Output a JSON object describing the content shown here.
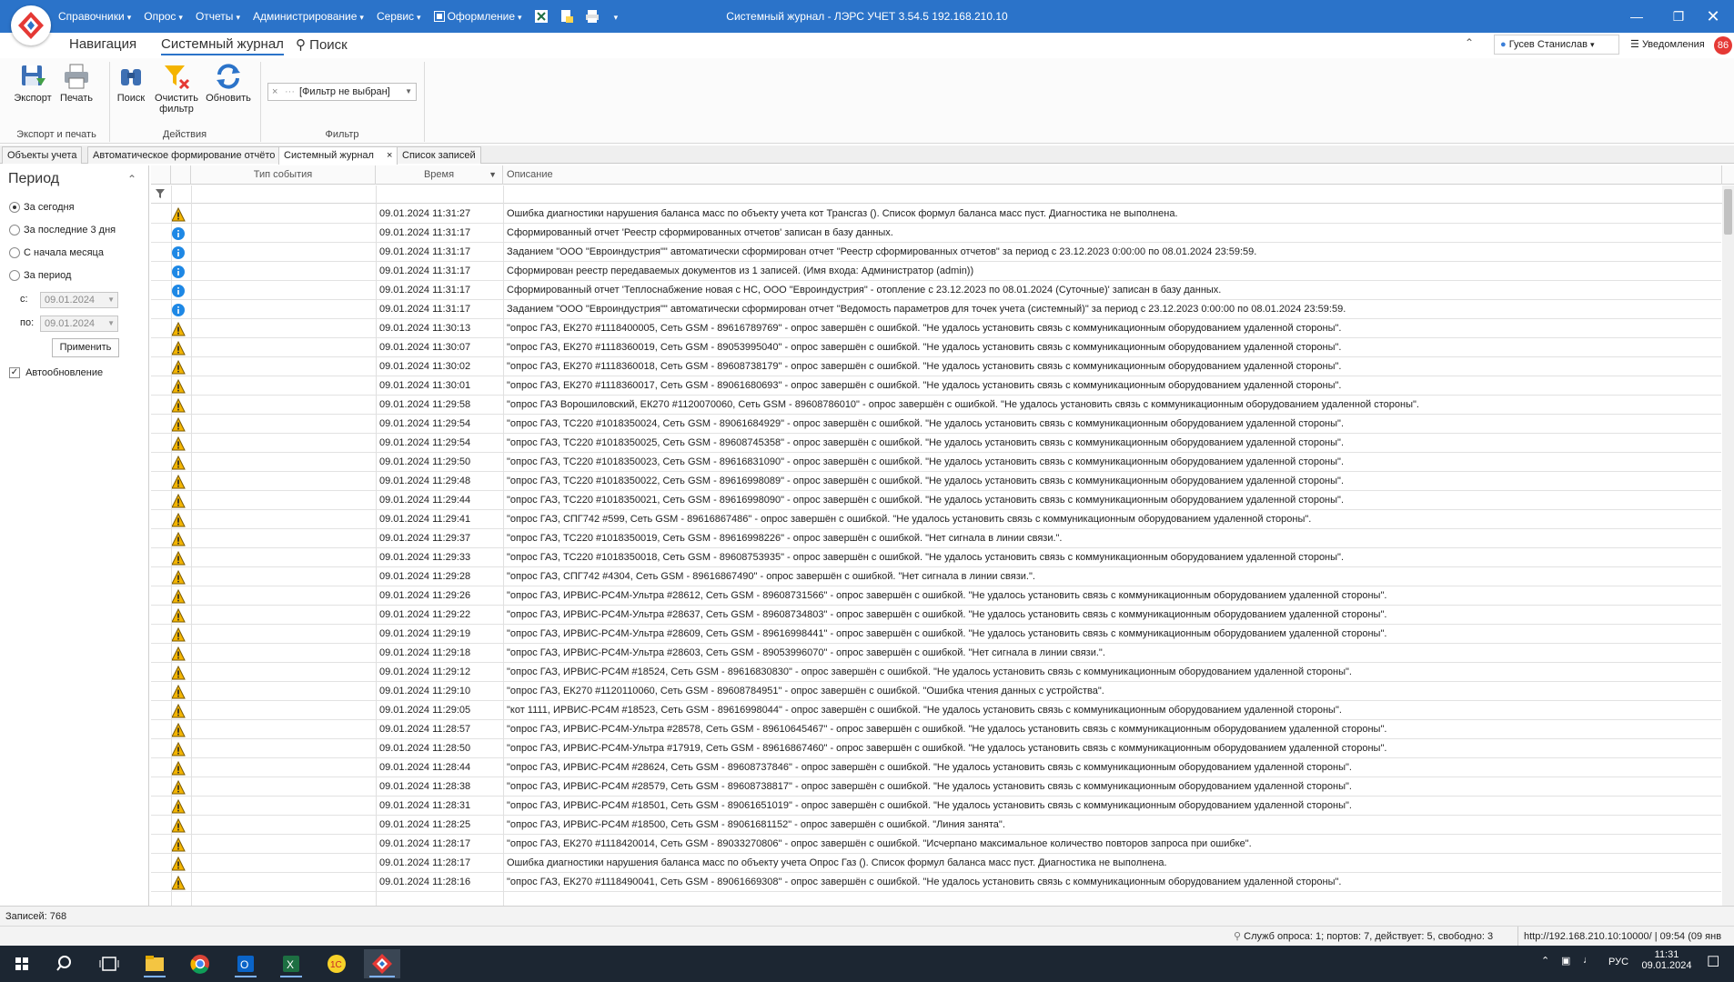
{
  "app": {
    "title": "Системный журнал - ЛЭРС УЧЕТ 3.54.5 192.168.210.10",
    "menu": [
      "Справочники",
      "Опрос",
      "Отчеты",
      "Администрирование",
      "Сервис",
      "Оформление"
    ],
    "window_controls": [
      "minimize",
      "restore",
      "close"
    ]
  },
  "ribbon_tabs": {
    "navigation": "Навигация",
    "journal": "Системный журнал",
    "search": "Поиск"
  },
  "user": {
    "name": "Гусев Станислав",
    "notifications_label": "Уведомления",
    "notifications_count": "86"
  },
  "ribbon": {
    "export": "Экспорт",
    "print": "Печать",
    "group_export": "Экспорт и печать",
    "search": "Поиск",
    "clear_filter_1": "Очистить",
    "clear_filter_2": "фильтр",
    "refresh": "Обновить",
    "group_actions": "Действия",
    "filter_value": "[Фильтр не выбран]",
    "group_filter": "Фильтр"
  },
  "doc_tabs": [
    "Объекты учета",
    "Автоматическое формирование отчёто",
    "Системный журнал",
    "Список записей"
  ],
  "period": {
    "title": "Период",
    "options": [
      "За сегодня",
      "За последние 3 дня",
      "С начала месяца",
      "За период"
    ],
    "selected": 0,
    "from_label": "с:",
    "from_value": "09.01.2024",
    "to_label": "по:",
    "to_value": "09.01.2024",
    "apply": "Применить",
    "autoupdate": "Автообновление",
    "autoupdate_checked": true
  },
  "grid": {
    "columns": [
      "Тип события",
      "Время",
      "Описание"
    ],
    "rows": [
      {
        "type": "warning",
        "time": "09.01.2024 11:31:27",
        "desc": "Ошибка диагностики нарушения баланса масс по объекту учета кот Трансгаз (). Список формул баланса масс пуст. Диагностика не выполнена."
      },
      {
        "type": "info",
        "time": "09.01.2024 11:31:17",
        "desc": "Сформированный отчет 'Реестр сформированных отчетов' записан в базу данных."
      },
      {
        "type": "info",
        "time": "09.01.2024 11:31:17",
        "desc": "Заданием \"ООО \"Евроиндустрия\"\" автоматически сформирован отчет \"Реестр сформированных отчетов\" за период с 23.12.2023 0:00:00 по 08.01.2024 23:59:59."
      },
      {
        "type": "info",
        "time": "09.01.2024 11:31:17",
        "desc": "Сформирован реестр передаваемых документов из 1 записей.  (Имя входа: Администратор (admin))"
      },
      {
        "type": "info",
        "time": "09.01.2024 11:31:17",
        "desc": "Сформированный отчет 'Теплоснабжение новая с НС, ООО \"Евроиндустрия\" - отопление с 23.12.2023 по 08.01.2024 (Суточные)' записан в базу данных."
      },
      {
        "type": "info",
        "time": "09.01.2024 11:31:17",
        "desc": "Заданием \"ООО \"Евроиндустрия\"\" автоматически сформирован отчет \"Ведомость параметров для точек учета (системный)\" за период с 23.12.2023 0:00:00 по 08.01.2024 23:59:59."
      },
      {
        "type": "warning",
        "time": "09.01.2024 11:30:13",
        "desc": "\"опрос ГАЗ, ЕК270 #1118400005, Сеть GSM - 89616789769\" - опрос завершён с ошибкой. \"Не удалось установить связь с коммуникационным оборудованием удаленной стороны\"."
      },
      {
        "type": "warning",
        "time": "09.01.2024 11:30:07",
        "desc": "\"опрос ГАЗ, ЕК270 #1118360019, Сеть GSM - 89053995040\" - опрос завершён с ошибкой. \"Не удалось установить связь с коммуникационным оборудованием удаленной стороны\"."
      },
      {
        "type": "warning",
        "time": "09.01.2024 11:30:02",
        "desc": "\"опрос ГАЗ, ЕК270 #1118360018, Сеть GSM - 89608738179\" - опрос завершён с ошибкой. \"Не удалось установить связь с коммуникационным оборудованием удаленной стороны\"."
      },
      {
        "type": "warning",
        "time": "09.01.2024 11:30:01",
        "desc": "\"опрос ГАЗ, ЕК270 #1118360017, Сеть GSM - 89061680693\" - опрос завершён с ошибкой. \"Не удалось установить связь с коммуникационным оборудованием удаленной стороны\"."
      },
      {
        "type": "warning",
        "time": "09.01.2024 11:29:58",
        "desc": "\"опрос ГАЗ Ворошиловский, ЕК270 #1120070060, Сеть GSM - 89608786010\" - опрос завершён с ошибкой. \"Не удалось установить связь с коммуникационным оборудованием удаленной стороны\"."
      },
      {
        "type": "warning",
        "time": "09.01.2024 11:29:54",
        "desc": "\"опрос ГАЗ, ТС220 #1018350024, Сеть GSM - 89061684929\" - опрос завершён с ошибкой. \"Не удалось установить связь с коммуникационным оборудованием удаленной стороны\"."
      },
      {
        "type": "warning",
        "time": "09.01.2024 11:29:54",
        "desc": "\"опрос ГАЗ, ТС220 #1018350025, Сеть GSM - 89608745358\" - опрос завершён с ошибкой. \"Не удалось установить связь с коммуникационным оборудованием удаленной стороны\"."
      },
      {
        "type": "warning",
        "time": "09.01.2024 11:29:50",
        "desc": "\"опрос ГАЗ, ТС220 #1018350023, Сеть GSM - 89616831090\" - опрос завершён с ошибкой. \"Не удалось установить связь с коммуникационным оборудованием удаленной стороны\"."
      },
      {
        "type": "warning",
        "time": "09.01.2024 11:29:48",
        "desc": "\"опрос ГАЗ, ТС220 #1018350022, Сеть GSM - 89616998089\" - опрос завершён с ошибкой. \"Не удалось установить связь с коммуникационным оборудованием удаленной стороны\"."
      },
      {
        "type": "warning",
        "time": "09.01.2024 11:29:44",
        "desc": "\"опрос ГАЗ, ТС220 #1018350021, Сеть GSM - 89616998090\" - опрос завершён с ошибкой. \"Не удалось установить связь с коммуникационным оборудованием удаленной стороны\"."
      },
      {
        "type": "warning",
        "time": "09.01.2024 11:29:41",
        "desc": "\"опрос ГАЗ, СПГ742 #599, Сеть GSM - 89616867486\" - опрос завершён с ошибкой. \"Не удалось установить связь с коммуникационным оборудованием удаленной стороны\"."
      },
      {
        "type": "warning",
        "time": "09.01.2024 11:29:37",
        "desc": "\"опрос ГАЗ, ТС220 #1018350019, Сеть GSM - 89616998226\" - опрос завершён с ошибкой. \"Нет сигнала в линии связи.\"."
      },
      {
        "type": "warning",
        "time": "09.01.2024 11:29:33",
        "desc": "\"опрос ГАЗ, ТС220 #1018350018, Сеть GSM - 89608753935\" - опрос завершён с ошибкой. \"Не удалось установить связь с коммуникационным оборудованием удаленной стороны\"."
      },
      {
        "type": "warning",
        "time": "09.01.2024 11:29:28",
        "desc": "\"опрос ГАЗ, СПГ742 #4304, Сеть GSM - 89616867490\" - опрос завершён с ошибкой. \"Нет сигнала в линии связи.\"."
      },
      {
        "type": "warning",
        "time": "09.01.2024 11:29:26",
        "desc": "\"опрос ГАЗ, ИРВИС-РС4М-Ультра #28612, Сеть GSM - 89608731566\" - опрос завершён с ошибкой. \"Не удалось установить связь с коммуникационным оборудованием удаленной стороны\"."
      },
      {
        "type": "warning",
        "time": "09.01.2024 11:29:22",
        "desc": "\"опрос ГАЗ, ИРВИС-РС4М-Ультра #28637, Сеть GSM - 89608734803\" - опрос завершён с ошибкой. \"Не удалось установить связь с коммуникационным оборудованием удаленной стороны\"."
      },
      {
        "type": "warning",
        "time": "09.01.2024 11:29:19",
        "desc": "\"опрос ГАЗ, ИРВИС-РС4М-Ультра #28609, Сеть GSM - 89616998441\" - опрос завершён с ошибкой. \"Не удалось установить связь с коммуникационным оборудованием удаленной стороны\"."
      },
      {
        "type": "warning",
        "time": "09.01.2024 11:29:18",
        "desc": "\"опрос ГАЗ, ИРВИС-РС4М-Ультра #28603, Сеть GSM - 89053996070\" - опрос завершён с ошибкой. \"Нет сигнала в линии связи.\"."
      },
      {
        "type": "warning",
        "time": "09.01.2024 11:29:12",
        "desc": "\"опрос ГАЗ, ИРВИС-РС4М #18524, Сеть GSM - 89616830830\" - опрос завершён с ошибкой. \"Не удалось установить связь с коммуникационным оборудованием удаленной стороны\"."
      },
      {
        "type": "warning",
        "time": "09.01.2024 11:29:10",
        "desc": "\"опрос ГАЗ, ЕК270 #1120110060, Сеть GSM - 89608784951\" - опрос завершён с ошибкой. \"Ошибка чтения данных с устройства\"."
      },
      {
        "type": "warning",
        "time": "09.01.2024 11:29:05",
        "desc": "\"кот 1111, ИРВИС-РС4М #18523, Сеть GSM - 89616998044\" - опрос завершён с ошибкой. \"Не удалось установить связь с коммуникационным оборудованием удаленной стороны\"."
      },
      {
        "type": "warning",
        "time": "09.01.2024 11:28:57",
        "desc": "\"опрос ГАЗ, ИРВИС-РС4М-Ультра #28578, Сеть GSM - 89610645467\" - опрос завершён с ошибкой. \"Не удалось установить связь с коммуникационным оборудованием удаленной стороны\"."
      },
      {
        "type": "warning",
        "time": "09.01.2024 11:28:50",
        "desc": "\"опрос ГАЗ, ИРВИС-РС4М-Ультра #17919, Сеть GSM - 89616867460\" - опрос завершён с ошибкой. \"Не удалось установить связь с коммуникационным оборудованием удаленной стороны\"."
      },
      {
        "type": "warning",
        "time": "09.01.2024 11:28:44",
        "desc": "\"опрос ГАЗ, ИРВИС-РС4М #28624, Сеть GSM - 89608737846\" - опрос завершён с ошибкой. \"Не удалось установить связь с коммуникационным оборудованием удаленной стороны\"."
      },
      {
        "type": "warning",
        "time": "09.01.2024 11:28:38",
        "desc": "\"опрос ГАЗ, ИРВИС-РС4М #28579, Сеть GSM - 89608738817\" - опрос завершён с ошибкой. \"Не удалось установить связь с коммуникационным оборудованием удаленной стороны\"."
      },
      {
        "type": "warning",
        "time": "09.01.2024 11:28:31",
        "desc": "\"опрос ГАЗ, ИРВИС-РС4М #18501, Сеть GSM - 89061651019\" - опрос завершён с ошибкой. \"Не удалось установить связь с коммуникационным оборудованием удаленной стороны\"."
      },
      {
        "type": "warning",
        "time": "09.01.2024 11:28:25",
        "desc": "\"опрос ГАЗ, ИРВИС-РС4М #18500, Сеть GSM - 89061681152\" - опрос завершён с ошибкой. \"Линия занята\"."
      },
      {
        "type": "warning",
        "time": "09.01.2024 11:28:17",
        "desc": "\"опрос ГАЗ, ЕК270 #1118420014, Сеть GSM - 89033270806\" - опрос завершён с ошибкой. \"Исчерпано максимальное количество повторов запроса при ошибке\"."
      },
      {
        "type": "warning",
        "time": "09.01.2024 11:28:17",
        "desc": "Ошибка диагностики нарушения баланса масс по объекту учета Опрос Газ (). Список формул баланса масс пуст. Диагностика не выполнена."
      },
      {
        "type": "warning",
        "time": "09.01.2024 11:28:16",
        "desc": "\"опрос ГАЗ, ЕК270 #1118490041, Сеть GSM - 89061669308\" - опрос завершён с ошибкой. \"Не удалось установить связь с коммуникационным оборудованием удаленной стороны\"."
      }
    ]
  },
  "records": "Записей: 768",
  "status": {
    "poll": "Служб опроса: 1; портов: 7, действует: 5, свободно: 3",
    "server": "http://192.168.210.10:10000/ | 09:54 (09 янв"
  },
  "taskbar": {
    "lang": "РУС",
    "time": "11:31",
    "date": "09.01.2024"
  },
  "colors": {
    "accent": "#2b73c9",
    "warning": "#f2b400",
    "info": "#1e88e5",
    "badge": "#e53935"
  }
}
